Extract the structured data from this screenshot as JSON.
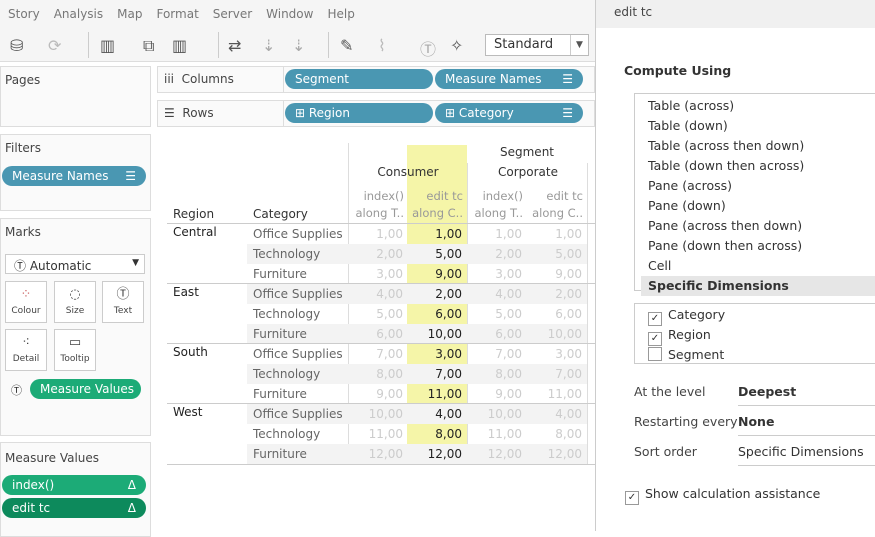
{
  "menu": [
    "Story",
    "Analysis",
    "Map",
    "Format",
    "Server",
    "Window",
    "Help"
  ],
  "toolbar": {
    "fit": "Standard"
  },
  "pages": {
    "title": "Pages"
  },
  "shelves": {
    "columns_label": "Columns",
    "rows_label": "Rows",
    "columns": [
      "Segment",
      "Measure Names"
    ],
    "rows": [
      "Region",
      "Category"
    ]
  },
  "filters": {
    "title": "Filters",
    "pill": "Measure Names"
  },
  "marks": {
    "title": "Marks",
    "type": "Automatic",
    "cards": [
      "Colour",
      "Size",
      "Text",
      "Detail",
      "Tooltip"
    ],
    "pill": "Measure Values"
  },
  "measure_values": {
    "title": "Measure Values",
    "items": [
      "index()",
      "edit tc"
    ]
  },
  "table": {
    "segment_header": "Segment",
    "region_header": "Region",
    "category_header": "Category",
    "segments": [
      "Consumer",
      "Corporate"
    ],
    "measures": [
      [
        "index()",
        "along T.."
      ],
      [
        "edit tc",
        "along C.."
      ],
      [
        "index()",
        "along T.."
      ],
      [
        "edit tc",
        "along C.."
      ]
    ],
    "highlight_color": "#f5f5a8",
    "rows": [
      {
        "region": "Central",
        "category": "Office Supplies",
        "values": [
          "1,00",
          "1,00",
          "1,00",
          "1,00"
        ]
      },
      {
        "region": "",
        "category": "Technology",
        "values": [
          "2,00",
          "5,00",
          "2,00",
          "5,00"
        ]
      },
      {
        "region": "",
        "category": "Furniture",
        "values": [
          "3,00",
          "9,00",
          "3,00",
          "9,00"
        ]
      },
      {
        "region": "East",
        "category": "Office Supplies",
        "values": [
          "4,00",
          "2,00",
          "4,00",
          "2,00"
        ]
      },
      {
        "region": "",
        "category": "Technology",
        "values": [
          "5,00",
          "6,00",
          "5,00",
          "6,00"
        ]
      },
      {
        "region": "",
        "category": "Furniture",
        "values": [
          "6,00",
          "10,00",
          "6,00",
          "10,00"
        ]
      },
      {
        "region": "South",
        "category": "Office Supplies",
        "values": [
          "7,00",
          "3,00",
          "7,00",
          "3,00"
        ]
      },
      {
        "region": "",
        "category": "Technology",
        "values": [
          "8,00",
          "7,00",
          "8,00",
          "7,00"
        ]
      },
      {
        "region": "",
        "category": "Furniture",
        "values": [
          "9,00",
          "11,00",
          "9,00",
          "11,00"
        ]
      },
      {
        "region": "West",
        "category": "Office Supplies",
        "values": [
          "10,00",
          "4,00",
          "10,00",
          "4,00"
        ]
      },
      {
        "region": "",
        "category": "Technology",
        "values": [
          "11,00",
          "8,00",
          "11,00",
          "8,00"
        ]
      },
      {
        "region": "",
        "category": "Furniture",
        "values": [
          "12,00",
          "12,00",
          "12,00",
          "12,00"
        ]
      }
    ]
  },
  "dialog": {
    "title": "edit tc",
    "compute_using": "Compute Using",
    "options": [
      "Table (across)",
      "Table (down)",
      "Table (across then down)",
      "Table (down then across)",
      "Pane (across)",
      "Pane (down)",
      "Pane (across then down)",
      "Pane (down then across)",
      "Cell",
      "Specific Dimensions"
    ],
    "selected": "Specific Dimensions",
    "dimensions": [
      {
        "label": "Category",
        "checked": true
      },
      {
        "label": "Region",
        "checked": true
      },
      {
        "label": "Segment",
        "checked": false
      }
    ],
    "at_level_label": "At the level",
    "at_level": "Deepest",
    "restart_label": "Restarting every",
    "restart": "None",
    "sort_label": "Sort order",
    "sort": "Specific Dimensions",
    "assist_label": "Show calculation assistance",
    "assist_checked": true
  }
}
